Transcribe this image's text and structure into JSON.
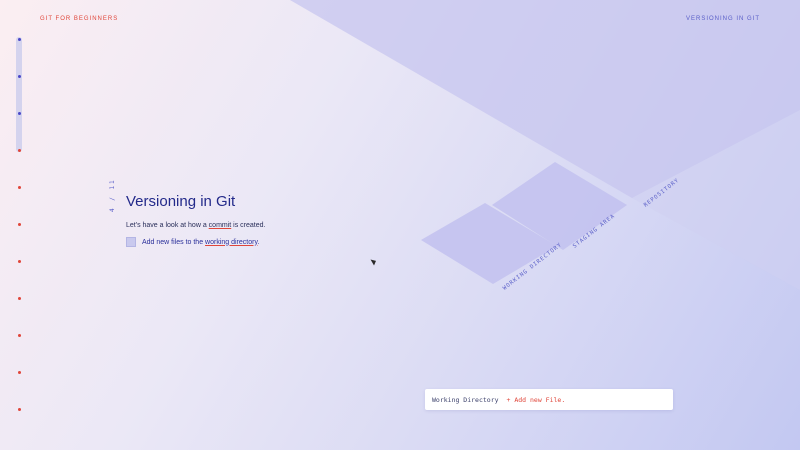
{
  "header": {
    "course_title": "GIT FOR BEGINNERS",
    "chapter_title": "VERSIONING IN GIT"
  },
  "navigation": {
    "total_dots": 11,
    "active_dots": 3,
    "active_color": "#4a48c8",
    "inactive_color": "#e0463a"
  },
  "slide": {
    "counter": "4 / 11",
    "title": "Versioning in Git",
    "intro_before": "Let's have a look at how a ",
    "intro_link": "commit",
    "intro_after": " is created.",
    "task_before": "Add new files to the ",
    "task_link": "working directory",
    "task_after": "."
  },
  "diagram": {
    "stages": [
      "WORKING DIRECTORY",
      "STAGING AREA",
      "REPOSITORY"
    ]
  },
  "console": {
    "stage": "Working Directory",
    "action": "+ Add new File."
  },
  "colors": {
    "accent_red": "#e0463a",
    "accent_blue": "#5a5fc8",
    "title_blue": "#232a8a"
  }
}
